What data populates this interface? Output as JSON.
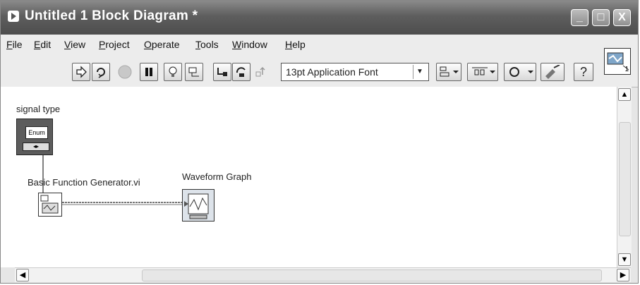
{
  "window": {
    "title": "Untitled 1 Block Diagram *",
    "controls": {
      "minimize": "_",
      "maximize": "□",
      "close": "X"
    }
  },
  "menu": {
    "items": [
      {
        "mnemonic": "F",
        "rest": "ile"
      },
      {
        "mnemonic": "E",
        "rest": "dit"
      },
      {
        "mnemonic": "V",
        "rest": "iew"
      },
      {
        "mnemonic": "P",
        "rest": "roject"
      },
      {
        "mnemonic": "O",
        "rest": "perate"
      },
      {
        "mnemonic": "T",
        "rest": "ools"
      },
      {
        "mnemonic": "W",
        "rest": "indow"
      },
      {
        "mnemonic": "H",
        "rest": "elp"
      }
    ]
  },
  "toolbar": {
    "font": "13pt Application Font",
    "help": "?",
    "icon_labels": [
      "run-arrow-icon",
      "run-continuous-icon",
      "abort-icon",
      "pause-icon",
      "highlight-execution-icon",
      "retain-wire-values-icon",
      "step-into-icon",
      "step-over-icon",
      "step-out-icon",
      "align-objects-icon",
      "distribute-objects-icon",
      "reorder-icon",
      "cleanup-diagram-icon",
      "context-help-icon"
    ]
  },
  "vi_icon": {
    "number": "1"
  },
  "diagram": {
    "signal_type_label": "signal type",
    "enum_text": "Enum",
    "generator_label": "Basic Function Generator.vi",
    "graph_label": "Waveform Graph"
  },
  "colors": {
    "titlebar": "#5e5e5e",
    "enum_terminal": "#6b6b6b",
    "wire": "#555555"
  }
}
